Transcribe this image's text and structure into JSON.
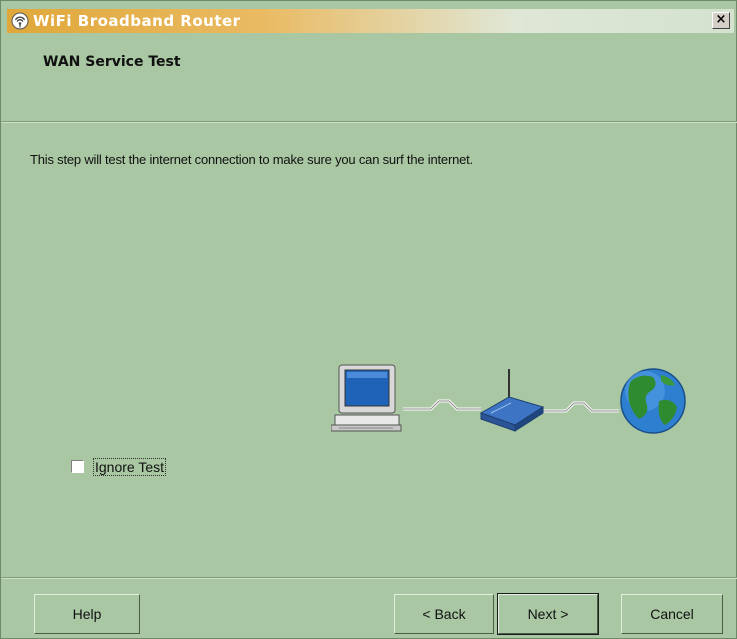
{
  "window": {
    "title": "WiFi Broadband Router",
    "close_label": "×"
  },
  "header": {
    "title": "WAN Service Test"
  },
  "body": {
    "description": "This step will test the internet connection to make sure you can surf the internet."
  },
  "diagram": {
    "icons": [
      "computer-icon",
      "router-icon",
      "globe-icon"
    ]
  },
  "options": {
    "ignore_test_label": "Ignore Test",
    "ignore_test_checked": false
  },
  "buttons": {
    "help": "Help",
    "back": "< Back",
    "next": "Next >",
    "cancel": "Cancel"
  },
  "colors": {
    "background": "#a9c7a3",
    "titlebar_start": "#e0a83a",
    "titlebar_end": "#d4e2cf"
  }
}
